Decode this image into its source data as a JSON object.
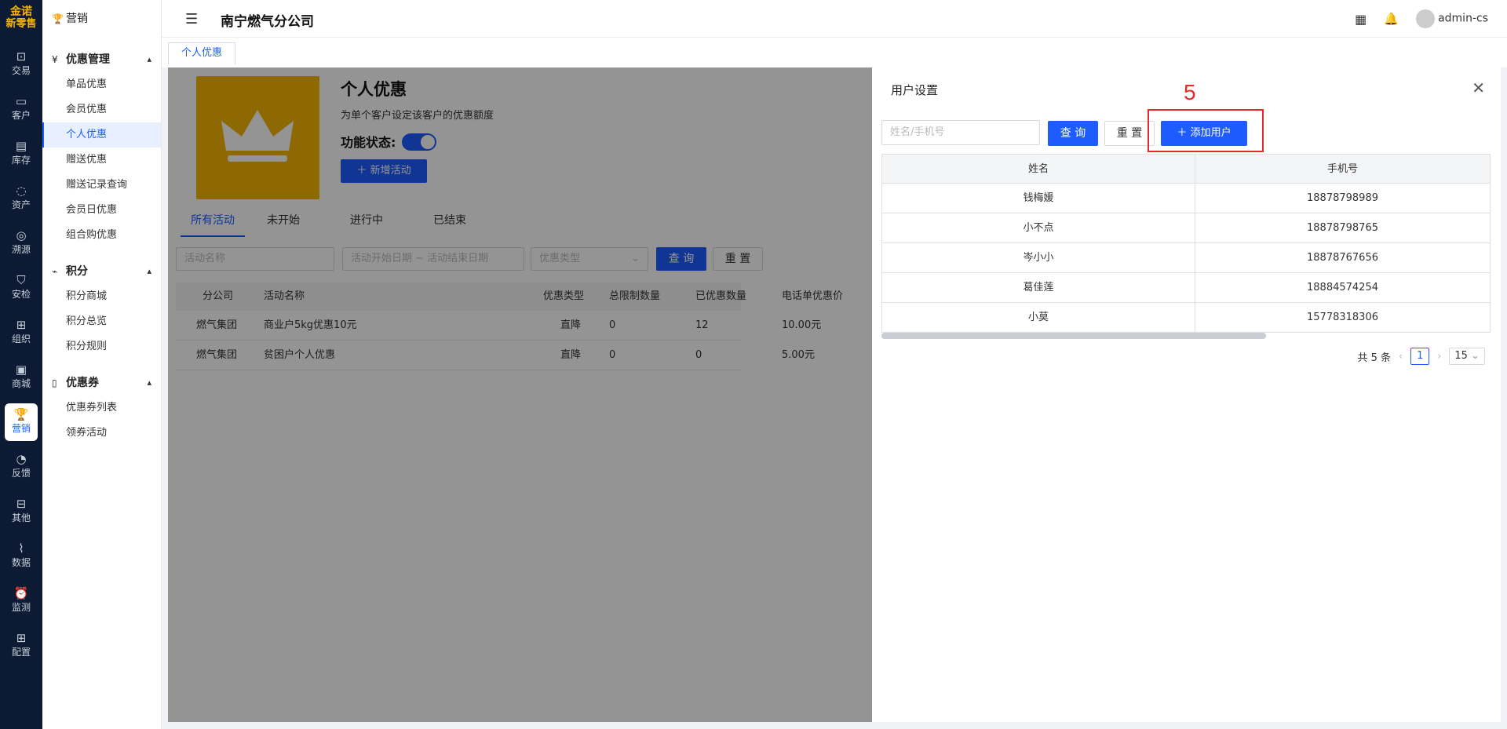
{
  "brand": {
    "line1": "金诺",
    "line2": "新零售"
  },
  "rail": [
    {
      "label": "交易",
      "icon": "bag-icon"
    },
    {
      "label": "客户",
      "icon": "id-card-icon"
    },
    {
      "label": "库存",
      "icon": "inventory-icon"
    },
    {
      "label": "资产",
      "icon": "bulb-icon"
    },
    {
      "label": "溯源",
      "icon": "compass-icon"
    },
    {
      "label": "安检",
      "icon": "shield-icon"
    },
    {
      "label": "组织",
      "icon": "org-icon"
    },
    {
      "label": "商城",
      "icon": "store-icon"
    },
    {
      "label": "营销",
      "icon": "trophy-icon",
      "active": true
    },
    {
      "label": "反馈",
      "icon": "chat-icon"
    },
    {
      "label": "其他",
      "icon": "blocks-icon"
    },
    {
      "label": "数据",
      "icon": "chart-icon"
    },
    {
      "label": "监测",
      "icon": "alarm-icon"
    },
    {
      "label": "配置",
      "icon": "grid-icon"
    }
  ],
  "menu": {
    "head": "营销",
    "groups": [
      {
        "label": "优惠管理",
        "items": [
          "单品优惠",
          "会员优惠",
          "个人优惠",
          "赠送优惠",
          "赠送记录查询",
          "会员日优惠",
          "组合购优惠"
        ]
      },
      {
        "label": "积分",
        "items": [
          "积分商城",
          "积分总览",
          "积分规则"
        ]
      },
      {
        "label": "优惠券",
        "items": [
          "优惠券列表",
          "领券活动"
        ]
      }
    ],
    "active_item": "个人优惠"
  },
  "topbar": {
    "company": "南宁燃气分公司",
    "user": "admin-cs"
  },
  "tabs": [
    "个人优惠"
  ],
  "page": {
    "title": "个人优惠",
    "desc": "为单个客户设定该客户的优惠额度",
    "status_label": "功能状态:",
    "status_on": true,
    "add_btn": "新增活动",
    "subtabs": [
      "所有活动",
      "未开始",
      "进行中",
      "已结束"
    ],
    "filters": {
      "name_ph": "活动名称",
      "date_ph": "活动开始日期 ~ 活动结束日期",
      "type_ph": "优惠类型",
      "query": "查 询",
      "reset": "重 置"
    },
    "table": {
      "headers": [
        "分公司",
        "活动名称",
        "优惠类型",
        "总限制数量",
        "已优惠数量",
        "电话单优惠价"
      ],
      "rows": [
        [
          "燃气集团",
          "商业户5kg优惠10元",
          "直降",
          "0",
          "12",
          "10.00元"
        ],
        [
          "燃气集团",
          "贫困户个人优惠",
          "直降",
          "0",
          "0",
          "5.00元"
        ]
      ]
    }
  },
  "drawer": {
    "title": "用户设置",
    "search_ph": "姓名/手机号",
    "query": "查 询",
    "reset": "重 置",
    "add_user": "添加用户",
    "annotation": "5",
    "headers": [
      "姓名",
      "手机号"
    ],
    "rows": [
      [
        "钱梅媛",
        "18878798989"
      ],
      [
        "小不点",
        "18878798765"
      ],
      [
        "岑小小",
        "18878767656"
      ],
      [
        "葛佳莲",
        "18884574254"
      ],
      [
        "小莫",
        "15778318306"
      ]
    ],
    "total": "共 5 条",
    "current_page": "1",
    "page_size": "15"
  }
}
